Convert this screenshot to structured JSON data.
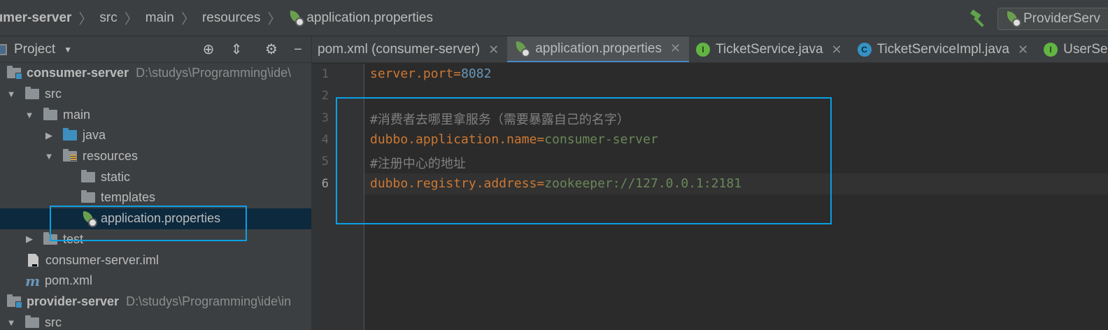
{
  "breadcrumb": {
    "items": [
      "sumer-server",
      "src",
      "main",
      "resources",
      "application.properties"
    ],
    "separator": "〉"
  },
  "run_config": {
    "label": "ProviderServ"
  },
  "project_panel": {
    "title": "Project",
    "tree": [
      {
        "label": "consumer-server",
        "path": "D:\\studys\\Programming\\ide\\"
      },
      {
        "label": "src"
      },
      {
        "label": "main"
      },
      {
        "label": "java"
      },
      {
        "label": "resources"
      },
      {
        "label": "static"
      },
      {
        "label": "templates"
      },
      {
        "label": "application.properties"
      },
      {
        "label": "test"
      },
      {
        "label": "consumer-server.iml"
      },
      {
        "label": "pom.xml"
      },
      {
        "label": "provider-server",
        "path": "D:\\studys\\Programming\\ide\\in"
      },
      {
        "label": "src"
      }
    ]
  },
  "editor_tabs": [
    {
      "label": "pom.xml (consumer-server)",
      "active": false
    },
    {
      "label": "application.properties",
      "active": true
    },
    {
      "label": "TicketService.java",
      "badge": "I"
    },
    {
      "label": "TicketServiceImpl.java",
      "badge": "C"
    },
    {
      "label": "UserSer",
      "badge": "I"
    }
  ],
  "editor": {
    "line_numbers": [
      "1",
      "2",
      "3",
      "4",
      "5",
      "6"
    ],
    "lines": [
      {
        "key": "server.port",
        "eq": "=",
        "value": "8082"
      },
      {
        "text": ""
      },
      {
        "comment": "#消费者去哪里拿服务（需要暴露自己的名字）"
      },
      {
        "key": "dubbo.application.name",
        "eq": "=",
        "value": "consumer-server"
      },
      {
        "comment": "#注册中心的地址"
      },
      {
        "key": "dubbo.registry.address",
        "eq": "=",
        "value": "zookeeper://127.0.0.1:2181"
      }
    ]
  },
  "colors": {
    "highlight_box": "#0aa0e6",
    "key": "#cc7832",
    "string_value": "#6a8759",
    "number": "#6897bb",
    "comment": "#808080",
    "selection": "#0d293e"
  }
}
